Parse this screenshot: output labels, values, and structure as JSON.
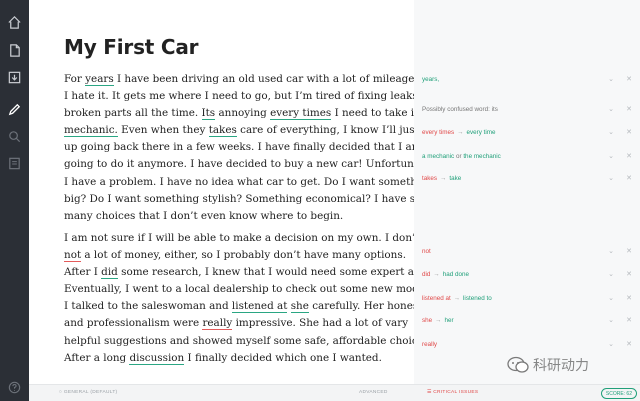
{
  "document": {
    "title": "My First Car",
    "paragraph1": [
      "For years I have been driving an old used car with a lot of mileage and",
      "I hate it. It gets me where I need to go, but I’m tired of fixing leaks and",
      "broken parts all the time. Its annoying every times I need to take it to",
      "mechanic. Even when they takes care of everything, I know I’ll just end",
      "up going back there in a few weeks. I have finally decided that I am not",
      "going to do it anymore. I have decided to buy a new car! Unfortunately,",
      "I have a problem. I have no idea what car to get. Do I want something",
      "big? Do I want something stylish? Something economical? I have so",
      "many choices that I don’t even know where to begin."
    ],
    "paragraph2": [
      "I am not sure if I will be able to make a decision on my own. I don’t have",
      "not  a lot of money, either, so I probably don’t have many options.",
      "After I did some research, I knew that I would need some expert advice.",
      "Eventually, I went to a local dealership to check out some new models.",
      "I talked to the saleswoman and listened at she carefully. Her honesty",
      "and professionalism were really impressive. She had a lot of vary",
      "helpful suggestions and showed myself some safe, affordable choices.",
      "After a long discussion I finally decided which one I wanted."
    ]
  },
  "issues": [
    {
      "before": "",
      "after": "years,",
      "note": ""
    },
    {
      "before": "",
      "after": "",
      "note": "Possibly confused word: its"
    },
    {
      "before": "every times",
      "after": "every time",
      "note": ""
    },
    {
      "before": "a mechanic",
      "after": "the mechanic",
      "note": "",
      "before_prefix": "a mechanic",
      "mid": "or"
    },
    {
      "before": "takes",
      "after": "take",
      "note": ""
    },
    {
      "before": "not",
      "after": "",
      "note": ""
    },
    {
      "before": "did",
      "after": "had done",
      "note": ""
    },
    {
      "before": "listened at",
      "after": "listened to",
      "note": ""
    },
    {
      "before": "she",
      "after": "her",
      "note": ""
    },
    {
      "before": "really",
      "after": "",
      "note": ""
    }
  ],
  "footer": {
    "general": "GENERAL (DEFAULT)",
    "advanced": "ADVANCED",
    "critical": "CRITICAL ISSUES",
    "score": "SCORE: 62"
  },
  "watermark": "科研动力",
  "colors": {
    "sidebar": "#2b2f36",
    "accent_green": "#21a07a",
    "error_red": "#e04848"
  }
}
